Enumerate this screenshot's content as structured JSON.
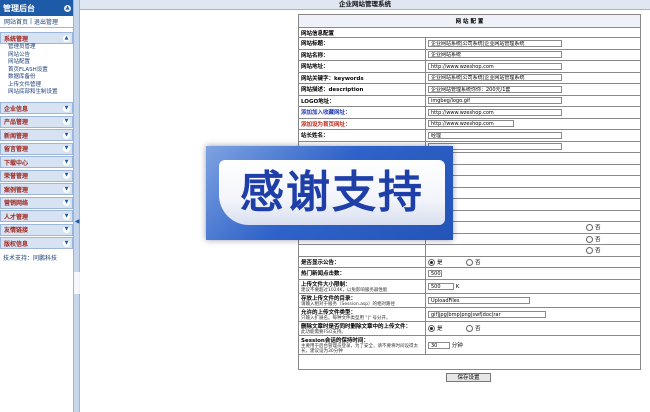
{
  "sidebar": {
    "logo": "管理后台",
    "top_links": [
      "网站首页",
      "|",
      "退出管理"
    ],
    "system": {
      "title": "系统管理",
      "items": [
        "管理员管理",
        "网站公告",
        "网站配置",
        "首页FLASH设置",
        "数据库备份",
        "上传文件管理",
        "网站底部和生制设置"
      ]
    },
    "categories": [
      "企业信息",
      "产品管理",
      "新闻管理",
      "留言管理",
      "下载中心",
      "荣誉管理",
      "案例管理",
      "营销网络",
      "人才管理",
      "友情链接",
      "版权信息"
    ],
    "support": "技术支持：同鹏科技"
  },
  "main": {
    "top_title": "企业网站管理系统",
    "table_title": "网 站 配 置",
    "group_title": "网站信息配置",
    "fields": [
      {
        "label": "网站标题：",
        "value": "企业网站系统|公司系统|企业网站管理系统"
      },
      {
        "label": "网站名称：",
        "value": "企业网站系统"
      },
      {
        "label": "网站地址：",
        "value": "http://www.wzeshop.com"
      },
      {
        "label": "网站关键字：keywords",
        "value": "企业网站系统|公司系统|企业网站管理系统"
      },
      {
        "label": "网站描述：description",
        "value": "企业网站管理系统你你：200元/1套"
      },
      {
        "label": "LOGO地址：",
        "value": "imgbeg/logo.gif"
      },
      {
        "label": "添加加入收藏网址：",
        "value": "http://www.wzeshop.com"
      },
      {
        "label": "添加设为首页网址：",
        "value": "http://www.wzeshop.com"
      },
      {
        "label": "站长姓名：",
        "value": "经理"
      }
    ],
    "radio_yes": "是",
    "radio_no": "否",
    "show_notice_label": "是否显示公告：",
    "hot_news_label": "热门新闻点击数：",
    "hot_news_value": "500",
    "upload_limit_label": "上传文件大小限制：",
    "upload_limit_hint": "建议不要超过1024K，以免影响服务器性能",
    "upload_limit_value": "500",
    "upload_limit_unit": "K",
    "upload_dir_label": "存放上传文件的目录：",
    "upload_dir_hint": "请输入相对于服务（Session.asp）的相对路径",
    "upload_dir_value": "UploadFiles",
    "file_types_label": "允许的上传文件类型：",
    "file_types_hint": "只输入扩展名。每种文件类型用 \"|\" 号分开。",
    "file_types_value": "gif|jpg|bmp|png|swf|doc|rar",
    "delete_files_label": "删除文章时是否同时删除文章中的上传文件：",
    "delete_files_hint": "此功能需要FSO支持。",
    "session_label": "Session会话的保持时间：",
    "session_hint": "主要用于后台管理员登录，为了安全，请不要将时间设得太长，建议设为30分钟",
    "session_value": "30",
    "session_unit": "分钟",
    "save_button": "保存设置"
  },
  "overlay": {
    "text": "感谢支持"
  }
}
